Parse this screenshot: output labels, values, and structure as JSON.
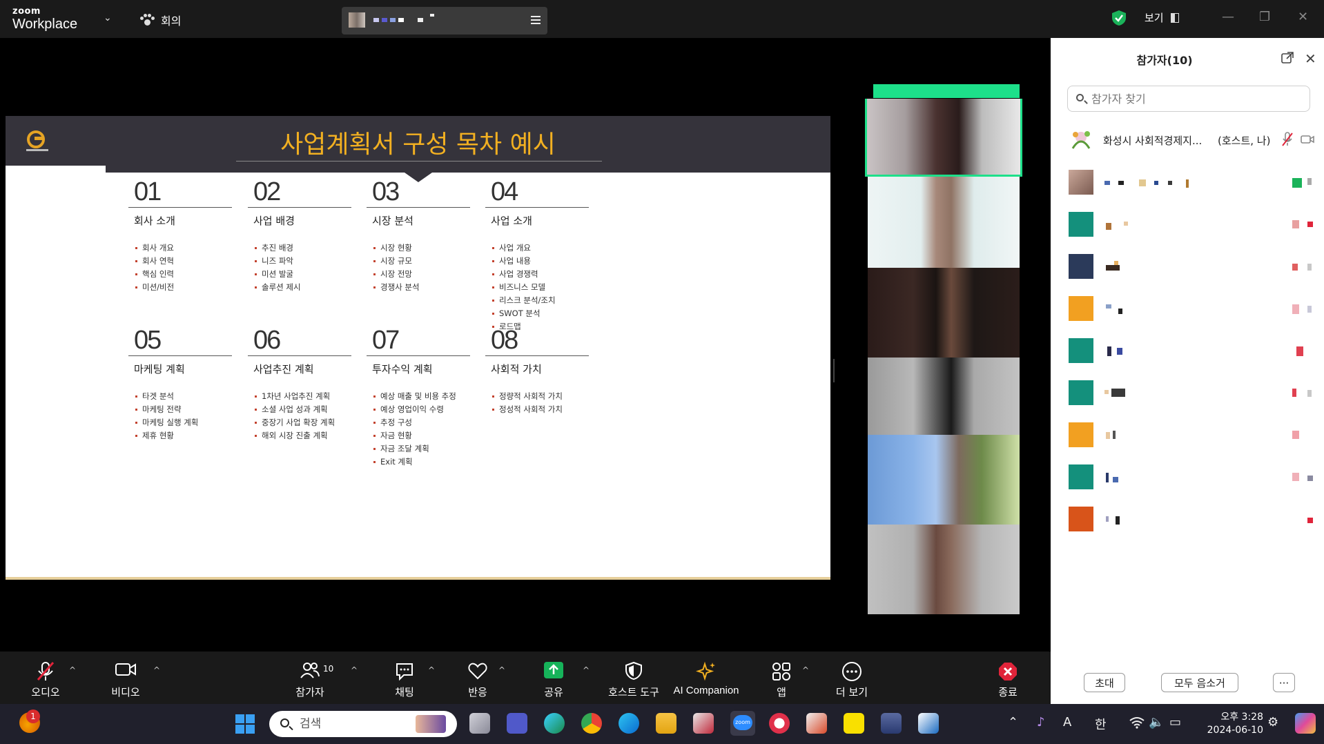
{
  "app": {
    "brand_top": "zoom",
    "brand_bottom": "Workplace",
    "meeting_label": "회의",
    "view_label": "보기"
  },
  "slide": {
    "title": "사업계획서 구성 목차 예시",
    "sections": [
      {
        "num": "01",
        "heading": "회사 소개",
        "items": [
          "회사 개요",
          "회사 연혁",
          "핵심 인력",
          "미션/비전"
        ]
      },
      {
        "num": "02",
        "heading": "사업 배경",
        "items": [
          "추진 배경",
          "니즈 파악",
          "미션 발굴",
          "솔루션 제시"
        ]
      },
      {
        "num": "03",
        "heading": "시장 분석",
        "items": [
          "시장 현황",
          "시장 규모",
          "시장 전망",
          "경쟁사 분석"
        ]
      },
      {
        "num": "04",
        "heading": "사업 소개",
        "items": [
          "사업 개요",
          "사업 내용",
          "사업 경쟁력",
          "비즈니스 모델",
          "리스크 분석/조치",
          "SWOT 분석",
          "로드맵"
        ]
      },
      {
        "num": "05",
        "heading": "마케팅 계획",
        "items": [
          "타겟 분석",
          "마케팅 전략",
          "마케팅 실행 계획",
          "제휴 현황"
        ]
      },
      {
        "num": "06",
        "heading": "사업추진 계획",
        "items": [
          "1차년 사업추진 계획",
          "소셜 사업 성과 계획",
          "중장기 사업 확장 계획",
          "해외 시장 진출 계획"
        ]
      },
      {
        "num": "07",
        "heading": "투자수익 계획",
        "items": [
          "예상 매출 및 비용 추정",
          "예상 영업이익 수령",
          "추정 구성",
          "자금 현황",
          "자금 조달 계획",
          "Exit 계획"
        ]
      },
      {
        "num": "08",
        "heading": "사회적 가치",
        "items": [
          "정량적 사회적 가치",
          "정성적 사회적 가치"
        ]
      }
    ]
  },
  "panel": {
    "title": "참가자(10)",
    "search_placeholder": "참가자 찾기",
    "me_name": "화성시 사회적경제지...",
    "me_role": "(호스트, 나)",
    "invite_label": "초대",
    "mute_all_label": "모두 음소거",
    "more_label": "···"
  },
  "toolbar": {
    "audio": "오디오",
    "video": "비디오",
    "participants": "참가자",
    "participants_count": "10",
    "chat": "채팅",
    "react": "반응",
    "share": "공유",
    "host_tools": "호스트 도구",
    "ai": "AI Companion",
    "apps": "앱",
    "more": "더 보기",
    "end": "종료"
  },
  "taskbar": {
    "search_placeholder": "검색",
    "notification_count": "1",
    "ime_a": "A",
    "ime_han": "한",
    "time": "오후 3:28",
    "date": "2024-06-10"
  },
  "colors": {
    "accent_green": "#1de08a",
    "slide_title": "#f2b021",
    "end_red": "#e0243a",
    "share_green": "#16b35a"
  }
}
